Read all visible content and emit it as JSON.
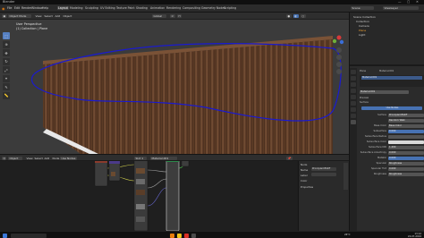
{
  "window": {
    "title": "Blender",
    "controls": [
      "—",
      "▢",
      "✕"
    ]
  },
  "menubar": {
    "menus": [
      "File",
      "Edit",
      "Render",
      "Window",
      "Help"
    ],
    "workspaces": [
      "Layout",
      "Modeling",
      "Sculpting",
      "UV Editing",
      "Texture Paint",
      "Shading",
      "Animation",
      "Rendering",
      "Compositing",
      "Geometry Nodes",
      "Scripting"
    ],
    "active_workspace": "Layout",
    "scene": "Scene",
    "view_layer": "ViewLayer"
  },
  "viewport": {
    "mode": "Object Mode",
    "menus": [
      "View",
      "Select",
      "Add",
      "Object"
    ],
    "transform": "Global",
    "info_line1": "User Perspective",
    "info_line2": "(1) Collection | Plane"
  },
  "outliner": {
    "rows": [
      "Scene Collection",
      "Collection",
      "Camera",
      "Plane",
      "Light"
    ]
  },
  "properties": {
    "object": "Plane",
    "material_name": "Material.001",
    "material_slot": "Material.001",
    "preview_label": "Preview",
    "surface_label": "Surface",
    "surface_value": "Principled BSDF",
    "button_label": "Use Nodes",
    "rows": [
      {
        "label": "Surface",
        "value": "Principled BSDF"
      },
      {
        "label": "",
        "value": "Random Walk"
      },
      {
        "label": "Base Color",
        "value": "Base Color"
      },
      {
        "label": "Subsurface",
        "value": "0.000"
      },
      {
        "label": "Subsurface Radius",
        "value": ""
      },
      {
        "label": "Subsurface Color",
        "value": ""
      },
      {
        "label": "Subsurface IOR",
        "value": "1.400"
      },
      {
        "label": "Subsurface Anisotropy",
        "value": "0.000"
      },
      {
        "label": "Metallic",
        "value": "0.000"
      },
      {
        "label": "Specular",
        "value": "Roughness"
      },
      {
        "label": "Specular Tint",
        "value": "0.000"
      },
      {
        "label": "Roughness",
        "value": "Roughness"
      }
    ]
  },
  "node_editor": {
    "mode": "Object",
    "menus": [
      "View",
      "Select",
      "Add",
      "Node"
    ],
    "use_nodes": "Use Nodes",
    "slot": "Slot 1",
    "material": "Material.001",
    "side_panel": {
      "title": "Node",
      "name_label": "Name",
      "name_value": "Principled BSDF",
      "label_label": "Label",
      "color_label": "Color",
      "properties_label": "Properties"
    }
  },
  "taskbar": {
    "temperature": "26°C",
    "time": "13:12",
    "date": "24-07-2024"
  },
  "colors": {
    "accent": "#4772b3",
    "annotation": "#1a1ad0",
    "wood_dark": "#4a2e1c",
    "wood_light": "#7a5236"
  }
}
